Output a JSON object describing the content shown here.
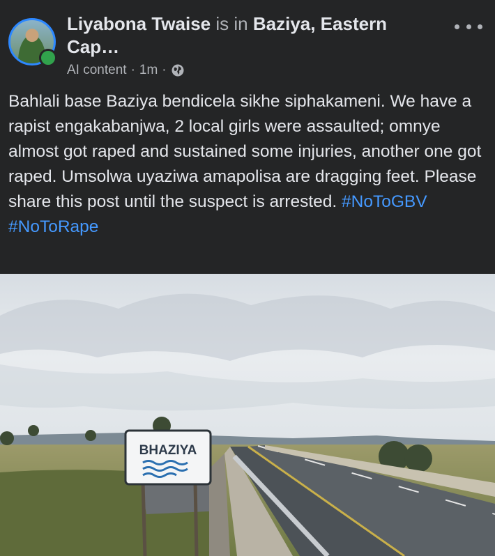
{
  "post": {
    "author": "Liyabona Twaise",
    "location_prefix": "is in",
    "location": "Baziya, Eastern Cap…",
    "meta_label": "AI content",
    "meta_sep1": "·",
    "time": "1m",
    "meta_sep2": "·",
    "audience_icon": "globe-icon",
    "body": "Bahlali base Baziya bendicela sikhe siphakameni.  We have a rapist engakabanjwa, 2 local girls were assaulted; omnye almost got raped and sustained some injuries, another one got raped. Umsolwa uyaziwa amapolisa are dragging feet. Please share this post until the suspect is arrested. ",
    "hashtags": [
      "#NoToGBV",
      "#NoToRape"
    ]
  },
  "photo": {
    "sign_text": "BHAZIYA"
  },
  "colors": {
    "background": "#242526",
    "text": "#e4e6eb",
    "muted": "#b0b3b8",
    "link": "#4599ff",
    "online": "#31a24c",
    "avatar_ring": "#2d88ff"
  }
}
